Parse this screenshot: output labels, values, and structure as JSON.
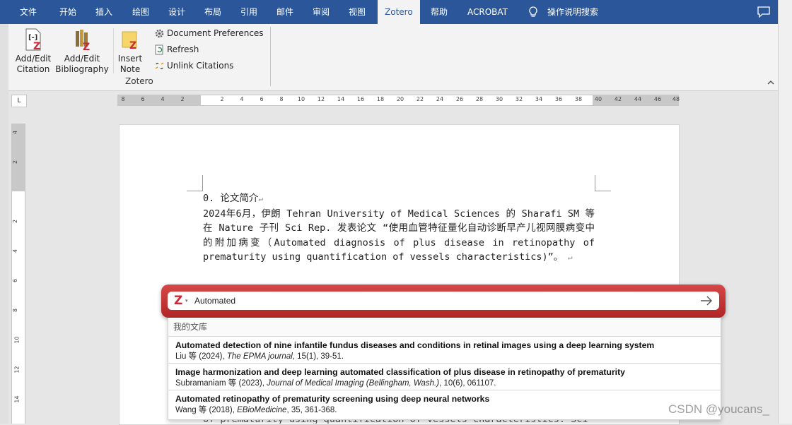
{
  "tabs": [
    "文件",
    "开始",
    "插入",
    "绘图",
    "设计",
    "布局",
    "引用",
    "邮件",
    "审阅",
    "视图",
    "Zotero",
    "帮助",
    "ACROBAT"
  ],
  "active_tab": "Zotero",
  "tell_me": "操作说明搜索",
  "ribbon": {
    "add_edit_citation": [
      "Add/Edit",
      "Citation"
    ],
    "add_edit_bibliography": [
      "Add/Edit",
      "Bibliography"
    ],
    "insert_note": [
      "Insert",
      "Note"
    ],
    "document_preferences": "Document Preferences",
    "refresh": "Refresh",
    "unlink_citations": "Unlink Citations",
    "group_label": "Zotero"
  },
  "ruler": {
    "horizontal": [
      "8",
      "6",
      "4",
      "2",
      "2",
      "4",
      "6",
      "8",
      "10",
      "12",
      "14",
      "16",
      "18",
      "20",
      "22",
      "24",
      "26",
      "28",
      "30",
      "32",
      "34",
      "36",
      "38",
      "40",
      "42",
      "44",
      "46",
      "48"
    ],
    "vertical": [
      "4",
      "2",
      "2",
      "4",
      "6",
      "8",
      "10",
      "12",
      "14"
    ],
    "corner": "L"
  },
  "document": {
    "heading": "0. 论文简介",
    "paragraph": "2024年6月，伊朗 Tehran University of Medical Sciences 的 Sharafi SM 等在 Nature 子刊 Sci Rep. 发表论文 “使用血管特征量化自动诊断早产儿视网膜病变中的附加病变（Automated diagnosis of plus disease in retinopathy of prematurity using quantification of vessels characteristics)”。",
    "partial_line": "of prematurity using quantification of vessels characteristics. Sci"
  },
  "zotero_popup": {
    "query": "Automated",
    "library_label": "我的文库",
    "results": [
      {
        "title": "Automated detection of nine infantile fundus diseases and conditions in retinal images using a deep learning system",
        "authors": "Liu 等 (2024), ",
        "journal": "The EPMA journal",
        "details": ", 15(1), 39-51."
      },
      {
        "title": "Image harmonization and deep learning automated classification of plus disease in retinopathy of prematurity",
        "authors": "Subramaniam 等 (2023), ",
        "journal": "Journal of Medical Imaging (Bellingham, Wash.)",
        "details": ", 10(6), 061107."
      },
      {
        "title": "Automated retinopathy of prematurity screening using deep neural networks",
        "authors": "Wang 等 (2018), ",
        "journal": "EBioMedicine",
        "details": ", 35, 361-368."
      }
    ]
  },
  "watermark": "CSDN @youcans_",
  "colors": {
    "word_blue": "#2b579a",
    "zotero_red": "#cc2936"
  }
}
